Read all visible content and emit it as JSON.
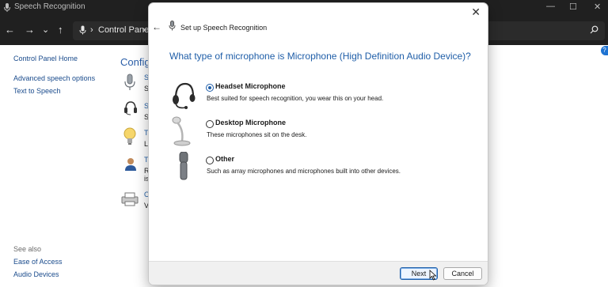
{
  "window": {
    "title": "Speech Recognition",
    "controls": [
      "—",
      "☐",
      "✕"
    ]
  },
  "nav": {
    "back": "←",
    "forward": "→",
    "dropdown": "⌄",
    "up": "↑",
    "crumb_sep": "›",
    "address_crumb": "Control Panel",
    "crumb_sep2": "›",
    "search_icon": "⌕"
  },
  "control_panel": {
    "home_link": "Control Panel Home",
    "links": [
      "Advanced speech options",
      "Text to Speech"
    ],
    "heading_partial": "Configu",
    "section_initials": [
      "S",
      "S",
      "S",
      "S",
      "T",
      "L",
      "T",
      "R",
      "is",
      "O",
      "V"
    ],
    "see_also_label": "See also",
    "see_also": [
      "Ease of Access",
      "Audio Devices"
    ],
    "help": "?"
  },
  "dialog": {
    "close": "✕",
    "back": "←",
    "title": "Set up Speech Recognition",
    "question": "What type of microphone is Microphone (High Definition Audio Device)?",
    "options": [
      {
        "name": "Headset Microphone",
        "description": "Best suited for speech recognition, you wear this on your head.",
        "selected": true,
        "icon": "headset-icon"
      },
      {
        "name": "Desktop Microphone",
        "description": "These microphones sit on the desk.",
        "selected": false,
        "icon": "desktop-microphone-icon"
      },
      {
        "name": "Other",
        "description": "Such as array microphones and microphones built into other devices.",
        "selected": false,
        "icon": "handheld-microphone-icon"
      }
    ],
    "buttons": {
      "next": "Next",
      "cancel": "Cancel"
    }
  }
}
